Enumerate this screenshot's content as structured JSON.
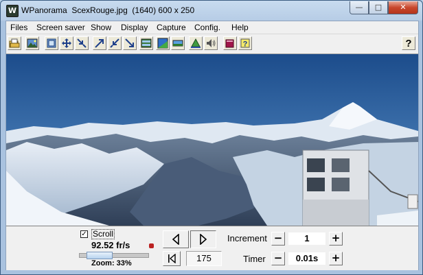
{
  "window": {
    "title": "WPanorama  ScexRouge.jpg  (1640) 600 x 250",
    "app_icon_glyph": "W",
    "minimize_glyph": "—",
    "maximize_glyph": "□",
    "close_glyph": "✕"
  },
  "menu": [
    "Files",
    "Screen saver",
    "Show",
    "Display",
    "Capture",
    "Config.",
    "Help"
  ],
  "toolbar": {
    "icons": [
      "open-file-icon",
      "picture-icon",
      "fit-window-icon",
      "move-icon",
      "shrink-icon",
      "expand-icon",
      "shrink-diagonal-icon",
      "expand-diagonal-icon",
      "filmstrip-icon",
      "gradient-icon",
      "panorama-strip-icon",
      "pyramid-icon",
      "speaker-icon",
      "book-icon",
      "help-topic-icon",
      "help-icon"
    ],
    "help_label": "?"
  },
  "panel": {
    "scroll_checked": true,
    "checkbox_mark": "✓",
    "scroll_label": "Scroll",
    "frame_rate": "92.52 fr/s",
    "zoom_label": "Zoom: 33%",
    "zoom_level": 0.33,
    "frame_value": "175",
    "increment_label": "Increment",
    "increment_value": "1",
    "timer_label": "Timer",
    "timer_value": "0.01s",
    "minus": "−",
    "plus": "+"
  },
  "colors": {
    "titlebar": "#c8dbef",
    "sky_top": "#1c4c8b",
    "sky_horizon": "#a9c4df",
    "close_button": "#c8472d"
  }
}
